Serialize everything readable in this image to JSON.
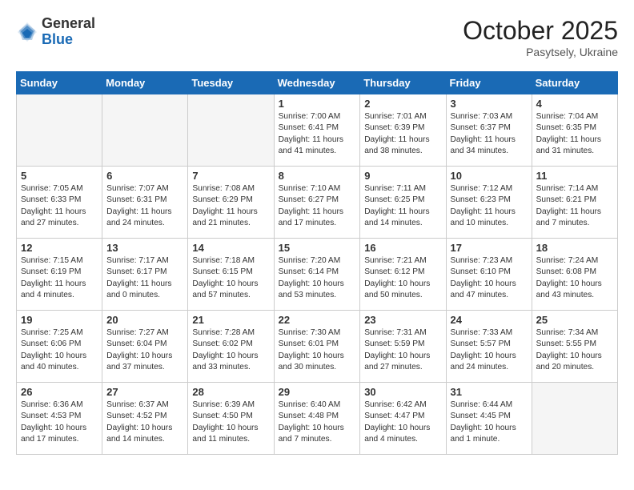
{
  "header": {
    "logo_general": "General",
    "logo_blue": "Blue",
    "month_title": "October 2025",
    "subtitle": "Pasytsely, Ukraine"
  },
  "weekdays": [
    "Sunday",
    "Monday",
    "Tuesday",
    "Wednesday",
    "Thursday",
    "Friday",
    "Saturday"
  ],
  "weeks": [
    [
      {
        "day": "",
        "info": ""
      },
      {
        "day": "",
        "info": ""
      },
      {
        "day": "",
        "info": ""
      },
      {
        "day": "1",
        "info": "Sunrise: 7:00 AM\nSunset: 6:41 PM\nDaylight: 11 hours\nand 41 minutes."
      },
      {
        "day": "2",
        "info": "Sunrise: 7:01 AM\nSunset: 6:39 PM\nDaylight: 11 hours\nand 38 minutes."
      },
      {
        "day": "3",
        "info": "Sunrise: 7:03 AM\nSunset: 6:37 PM\nDaylight: 11 hours\nand 34 minutes."
      },
      {
        "day": "4",
        "info": "Sunrise: 7:04 AM\nSunset: 6:35 PM\nDaylight: 11 hours\nand 31 minutes."
      }
    ],
    [
      {
        "day": "5",
        "info": "Sunrise: 7:05 AM\nSunset: 6:33 PM\nDaylight: 11 hours\nand 27 minutes."
      },
      {
        "day": "6",
        "info": "Sunrise: 7:07 AM\nSunset: 6:31 PM\nDaylight: 11 hours\nand 24 minutes."
      },
      {
        "day": "7",
        "info": "Sunrise: 7:08 AM\nSunset: 6:29 PM\nDaylight: 11 hours\nand 21 minutes."
      },
      {
        "day": "8",
        "info": "Sunrise: 7:10 AM\nSunset: 6:27 PM\nDaylight: 11 hours\nand 17 minutes."
      },
      {
        "day": "9",
        "info": "Sunrise: 7:11 AM\nSunset: 6:25 PM\nDaylight: 11 hours\nand 14 minutes."
      },
      {
        "day": "10",
        "info": "Sunrise: 7:12 AM\nSunset: 6:23 PM\nDaylight: 11 hours\nand 10 minutes."
      },
      {
        "day": "11",
        "info": "Sunrise: 7:14 AM\nSunset: 6:21 PM\nDaylight: 11 hours\nand 7 minutes."
      }
    ],
    [
      {
        "day": "12",
        "info": "Sunrise: 7:15 AM\nSunset: 6:19 PM\nDaylight: 11 hours\nand 4 minutes."
      },
      {
        "day": "13",
        "info": "Sunrise: 7:17 AM\nSunset: 6:17 PM\nDaylight: 11 hours\nand 0 minutes."
      },
      {
        "day": "14",
        "info": "Sunrise: 7:18 AM\nSunset: 6:15 PM\nDaylight: 10 hours\nand 57 minutes."
      },
      {
        "day": "15",
        "info": "Sunrise: 7:20 AM\nSunset: 6:14 PM\nDaylight: 10 hours\nand 53 minutes."
      },
      {
        "day": "16",
        "info": "Sunrise: 7:21 AM\nSunset: 6:12 PM\nDaylight: 10 hours\nand 50 minutes."
      },
      {
        "day": "17",
        "info": "Sunrise: 7:23 AM\nSunset: 6:10 PM\nDaylight: 10 hours\nand 47 minutes."
      },
      {
        "day": "18",
        "info": "Sunrise: 7:24 AM\nSunset: 6:08 PM\nDaylight: 10 hours\nand 43 minutes."
      }
    ],
    [
      {
        "day": "19",
        "info": "Sunrise: 7:25 AM\nSunset: 6:06 PM\nDaylight: 10 hours\nand 40 minutes."
      },
      {
        "day": "20",
        "info": "Sunrise: 7:27 AM\nSunset: 6:04 PM\nDaylight: 10 hours\nand 37 minutes."
      },
      {
        "day": "21",
        "info": "Sunrise: 7:28 AM\nSunset: 6:02 PM\nDaylight: 10 hours\nand 33 minutes."
      },
      {
        "day": "22",
        "info": "Sunrise: 7:30 AM\nSunset: 6:01 PM\nDaylight: 10 hours\nand 30 minutes."
      },
      {
        "day": "23",
        "info": "Sunrise: 7:31 AM\nSunset: 5:59 PM\nDaylight: 10 hours\nand 27 minutes."
      },
      {
        "day": "24",
        "info": "Sunrise: 7:33 AM\nSunset: 5:57 PM\nDaylight: 10 hours\nand 24 minutes."
      },
      {
        "day": "25",
        "info": "Sunrise: 7:34 AM\nSunset: 5:55 PM\nDaylight: 10 hours\nand 20 minutes."
      }
    ],
    [
      {
        "day": "26",
        "info": "Sunrise: 6:36 AM\nSunset: 4:53 PM\nDaylight: 10 hours\nand 17 minutes."
      },
      {
        "day": "27",
        "info": "Sunrise: 6:37 AM\nSunset: 4:52 PM\nDaylight: 10 hours\nand 14 minutes."
      },
      {
        "day": "28",
        "info": "Sunrise: 6:39 AM\nSunset: 4:50 PM\nDaylight: 10 hours\nand 11 minutes."
      },
      {
        "day": "29",
        "info": "Sunrise: 6:40 AM\nSunset: 4:48 PM\nDaylight: 10 hours\nand 7 minutes."
      },
      {
        "day": "30",
        "info": "Sunrise: 6:42 AM\nSunset: 4:47 PM\nDaylight: 10 hours\nand 4 minutes."
      },
      {
        "day": "31",
        "info": "Sunrise: 6:44 AM\nSunset: 4:45 PM\nDaylight: 10 hours\nand 1 minute."
      },
      {
        "day": "",
        "info": ""
      }
    ]
  ]
}
